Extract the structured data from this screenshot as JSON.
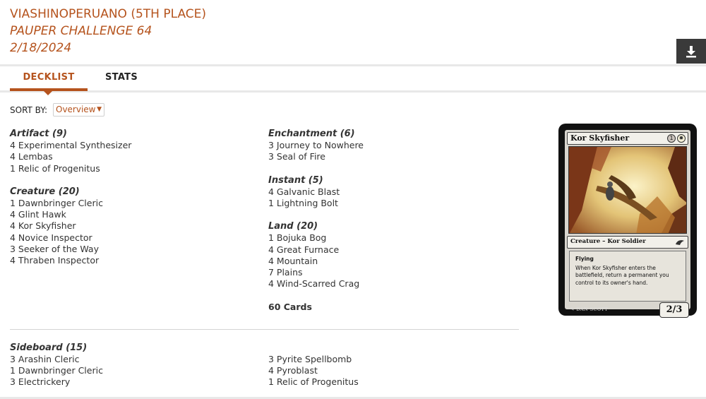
{
  "header": {
    "player": "VIASHINOPERUANO (5TH PLACE)",
    "event": "PAUPER CHALLENGE 64",
    "date": "2/18/2024"
  },
  "toolbar": {
    "download_icon": "download-icon"
  },
  "tabs": [
    {
      "label": "DECKLIST",
      "active": true
    },
    {
      "label": "STATS",
      "active": false
    }
  ],
  "sort": {
    "label": "SORT BY:",
    "value": "Overview"
  },
  "deck": {
    "left": [
      {
        "title": "Artifact (9)",
        "cards": [
          "4 Experimental Synthesizer",
          "4 Lembas",
          "1 Relic of Progenitus"
        ]
      },
      {
        "title": "Creature (20)",
        "cards": [
          "1 Dawnbringer Cleric",
          "4 Glint Hawk",
          "4 Kor Skyfisher",
          "4 Novice Inspector",
          "3 Seeker of the Way",
          "4 Thraben Inspector"
        ]
      }
    ],
    "right": [
      {
        "title": "Enchantment (6)",
        "cards": [
          "3 Journey to Nowhere",
          "3 Seal of Fire"
        ]
      },
      {
        "title": "Instant (5)",
        "cards": [
          "4 Galvanic Blast",
          "1 Lightning Bolt"
        ]
      },
      {
        "title": "Land (20)",
        "cards": [
          "1 Bojuka Bog",
          "4 Great Furnace",
          "4 Mountain",
          "7 Plains",
          "4 Wind-Scarred Crag"
        ]
      }
    ],
    "total": "60 Cards"
  },
  "sideboard": {
    "title": "Sideboard (15)",
    "left": [
      "3 Arashin Cleric",
      "1 Dawnbringer Cleric",
      "3 Electrickery"
    ],
    "right": [
      "3 Pyrite Spellbomb",
      "4 Pyroblast",
      "1 Relic of Progenitus"
    ]
  },
  "card_preview": {
    "name": "Kor Skyfisher",
    "cost": [
      "1",
      "W"
    ],
    "type": "Creature – Kor Soldier",
    "keyword": "Flying",
    "rules": "When Kor Skyfisher enters the battlefield, return a permanent you control to its owner's hand.",
    "artist": "DAN SCOTT",
    "pt": "2/3"
  },
  "colors": {
    "accent": "#b5531d",
    "text": "#333333",
    "rule": "#e8e8e8"
  }
}
